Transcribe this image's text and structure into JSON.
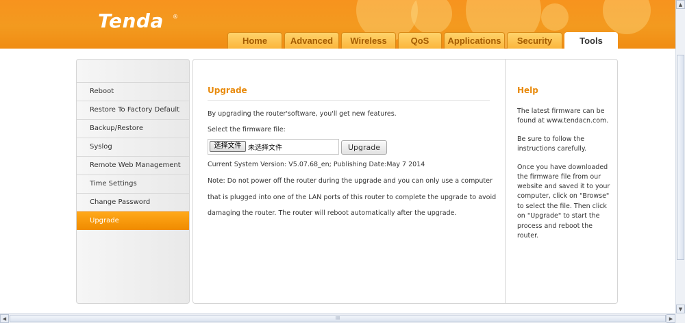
{
  "header": {
    "logo": "Tenda",
    "logo_mark": "®",
    "tabs": [
      "Home",
      "Advanced",
      "Wireless",
      "QoS",
      "Applications",
      "Security",
      "Tools"
    ],
    "active_tab": "Tools"
  },
  "sidebar": {
    "items": [
      "Reboot",
      "Restore To Factory Default",
      "Backup/Restore",
      "Syslog",
      "Remote Web Management",
      "Time Settings",
      "Change Password",
      "Upgrade"
    ],
    "active_item": "Upgrade"
  },
  "main": {
    "title": "Upgrade",
    "intro": "By upgrading the router'software, you'll get new features.",
    "select_label": "Select the firmware file:",
    "choose_button": "选择文件",
    "no_file_text": "未选择文件",
    "upgrade_button": "Upgrade",
    "version_text": "Current System Version: V5.07.68_en; Publishing Date:May 7 2014",
    "note_lines": [
      "Note: Do not power off the router during the upgrade and you can only use a computer",
      "that is plugged into one of the LAN ports of this router to complete the upgrade to avoid",
      "damaging the router. The router will reboot automatically after the upgrade."
    ]
  },
  "help": {
    "title": "Help",
    "lines": [
      "The latest firmware can be",
      "found at www.tendacn.com.",
      "",
      "Be sure to follow the",
      "instructions carefully.",
      "",
      "Once you have downloaded",
      "the firmware file from our",
      "website and saved it to your",
      "computer, click on \"Browse\"",
      "to select the file. Then click",
      "on \"Upgrade\" to start the",
      "process and reboot the",
      "router."
    ]
  },
  "scrollbars": {
    "grip": "III"
  },
  "colors": {
    "brand_orange": "#f7931e",
    "accent_text": "#e88a0c",
    "active_menu": "#f39200"
  }
}
